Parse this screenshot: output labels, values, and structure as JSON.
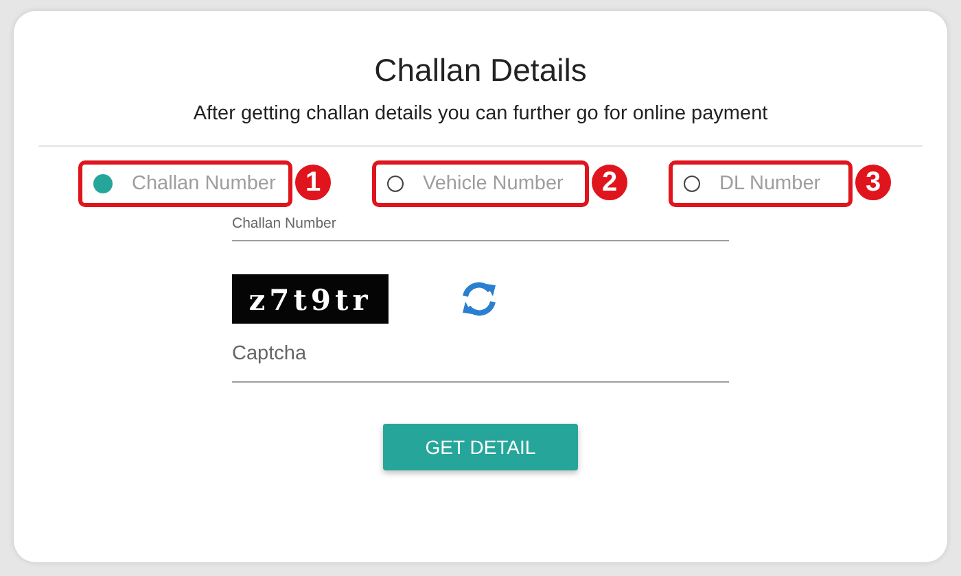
{
  "title": "Challan Details",
  "subtitle": "After getting challan details you can further go for online payment",
  "search_options": [
    {
      "label": "Challan Number",
      "selected": true,
      "callout": "1"
    },
    {
      "label": "Vehicle Number",
      "selected": false,
      "callout": "2"
    },
    {
      "label": "DL Number",
      "selected": false,
      "callout": "3"
    }
  ],
  "number_field": {
    "label": "Challan Number"
  },
  "captcha": {
    "code": "z7t9tr",
    "placeholder": "Captcha"
  },
  "submit_button": "GET DETAIL"
}
